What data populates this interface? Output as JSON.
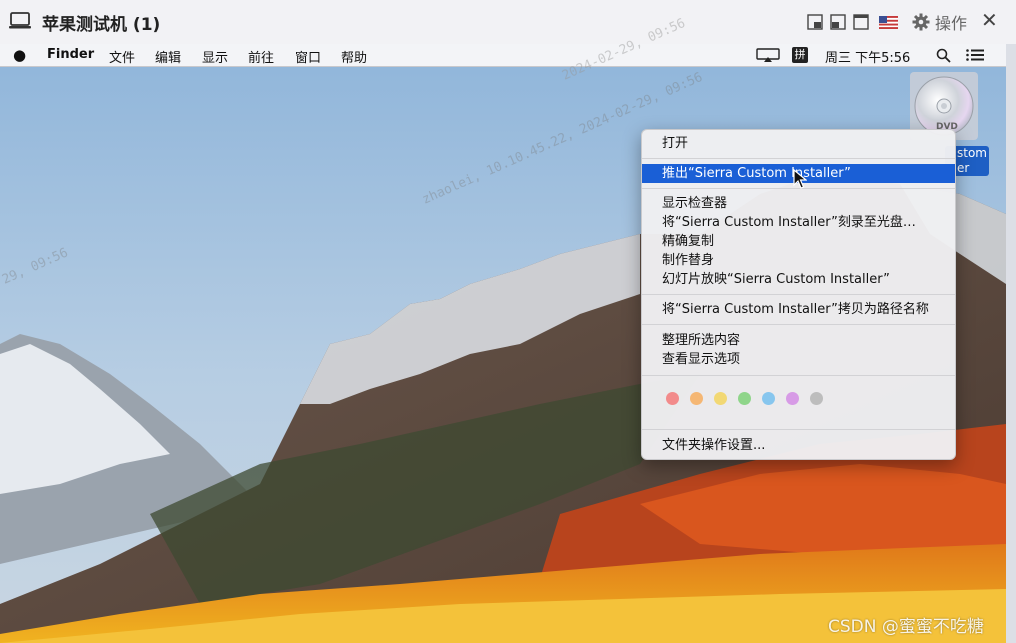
{
  "window": {
    "title": "苹果测试机 (1)",
    "operations_label": "操作"
  },
  "menubar": {
    "app": "Finder",
    "items": [
      "文件",
      "编辑",
      "显示",
      "前往",
      "窗口",
      "帮助"
    ],
    "input_method": "拼",
    "clock": "周三 下午5:56"
  },
  "desktop_icon": {
    "label_line1": "stom",
    "label_line2": "er"
  },
  "context_menu": {
    "items": [
      "打开",
      "推出“Sierra Custom Installer”",
      "显示检查器",
      "将“Sierra Custom Installer”刻录至光盘…",
      "精确复制",
      "制作替身",
      "幻灯片放映“Sierra Custom Installer”",
      "将“Sierra Custom Installer”拷贝为路径名称",
      "整理所选内容",
      "查看显示选项",
      "文件夹操作设置..."
    ],
    "highlighted_index": 1,
    "tag_colors": [
      "#f28b8b",
      "#f5b774",
      "#f2d874",
      "#8fd58a",
      "#87c6ee",
      "#d79be6",
      "#bdbdbd"
    ]
  },
  "watermarks": [
    "zhaolei, 10.10.45.22, 2024-02-29, 09:56",
    "2024-02-29, 09:56",
    "29, 09:56"
  ],
  "footer_watermark": "CSDN @蜜蜜不吃糖"
}
